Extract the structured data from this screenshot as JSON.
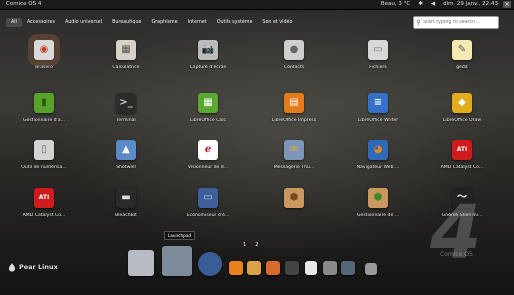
{
  "topbar": {
    "os_name": "Comice OS 4",
    "weather": "Beau, 3 °C",
    "bluetooth_icon": "bluetooth-icon",
    "volume_icon": "volume-icon",
    "datetime": "dim. 29 janv., 22:43",
    "close_glyph": "×"
  },
  "categories": [
    "All",
    "Accessoires",
    "Audio universel",
    "Bureautique",
    "Graphisme",
    "Internet",
    "Outils système",
    "Son et vidéo"
  ],
  "search": {
    "placeholder": "Start typing to search..."
  },
  "apps": [
    {
      "label": "Brasero",
      "color": "#d9d9d9",
      "accent": "#cc3a1a",
      "glyph": "◉"
    },
    {
      "label": "Calculatrice",
      "color": "#d6d3c6",
      "accent": "#555",
      "glyph": "▦"
    },
    {
      "label": "Capture d'écran",
      "color": "#bbbbbb",
      "accent": "#333",
      "glyph": "📷"
    },
    {
      "label": "Contacts",
      "color": "#cfcfcf",
      "accent": "#666",
      "glyph": "●"
    },
    {
      "label": "Fichiers",
      "color": "#d8d8d8",
      "accent": "#777",
      "glyph": "▭"
    },
    {
      "label": "gedit",
      "color": "#f4e9b0",
      "accent": "#556",
      "glyph": "✎"
    },
    {
      "label": "Gestionnaire d'a...",
      "color": "#58a22c",
      "accent": "#2d5a12",
      "glyph": "▮"
    },
    {
      "label": "Terminal",
      "color": "#2b2b2b",
      "accent": "#ccc",
      "glyph": ">_"
    },
    {
      "label": "LibreOffice Calc",
      "color": "#5aa832",
      "accent": "#fff",
      "glyph": "▦"
    },
    {
      "label": "LibreOffice Impress",
      "color": "#e47a1a",
      "accent": "#fff",
      "glyph": "▤"
    },
    {
      "label": "LibreOffice Writer",
      "color": "#3571c8",
      "accent": "#fff",
      "glyph": "≡"
    },
    {
      "label": "LibreOffice Draw",
      "color": "#e3ac1c",
      "accent": "#fff",
      "glyph": "◆"
    },
    {
      "label": "Outil de numérisa...",
      "color": "#d3d3d3",
      "accent": "#666",
      "glyph": "▯"
    },
    {
      "label": "Shotwell",
      "color": "#5a8ac8",
      "accent": "#fff",
      "glyph": "▲"
    },
    {
      "label": "Visionneur de d...",
      "color": "#ffffff",
      "accent": "#c0181e",
      "glyph": "ℯ"
    },
    {
      "label": "Messagerie Thu...",
      "color": "#7d95ba",
      "accent": "#d8b030",
      "glyph": "✉"
    },
    {
      "label": "Navigateur Web ...",
      "color": "#2e6ab8",
      "accent": "#e8861c",
      "glyph": "◕"
    },
    {
      "label": "AMD Catalyst Co...",
      "color": "#cf1b1b",
      "accent": "#fff",
      "glyph": "ATI"
    },
    {
      "label": "AMD Catalyst Co...",
      "color": "#cf1b1b",
      "accent": "#fff",
      "glyph": "ATI"
    },
    {
      "label": "BleachBit",
      "color": "#2a2a2a",
      "accent": "#ddd",
      "glyph": "▬"
    },
    {
      "label": "Économiseur d'é...",
      "color": "#3e5e9c",
      "accent": "#bcd",
      "glyph": "▭"
    },
    {
      "label": "",
      "color": "#c9985e",
      "accent": "#7a4a1e",
      "glyph": "⬢"
    },
    {
      "label": "Gestionnaire de ...",
      "color": "#c9985e",
      "accent": "#3a8a2a",
      "glyph": "⬢"
    },
    {
      "label": "Gnome Shell Ini...",
      "color": "#222222",
      "accent": "#eee",
      "glyph": "〜"
    }
  ],
  "tooltip": "Launchpad",
  "pages": [
    "1",
    "2"
  ],
  "dock": {
    "brand_text": "Pear Linux",
    "items": [
      {
        "name": "display-settings-icon",
        "color": "#b7bbc2"
      },
      {
        "name": "launchpad-icon",
        "color": "#7c8a99"
      },
      {
        "name": "app-store-icon",
        "color": "#3a5e93"
      },
      {
        "name": "firefox-icon",
        "color": "#e8821c"
      },
      {
        "name": "settings-icon",
        "color": "#d9a24a"
      },
      {
        "name": "photos-icon",
        "color": "#d86a30"
      },
      {
        "name": "video-player-icon",
        "color": "#444444"
      },
      {
        "name": "documents-icon",
        "color": "#e8e8e8"
      },
      {
        "name": "contacts-icon",
        "color": "#8a8a8a"
      },
      {
        "name": "system-monitor-icon",
        "color": "#556677"
      },
      {
        "name": "trash-icon",
        "color": "#999999"
      }
    ]
  },
  "watermark": {
    "number": "4",
    "brand": "Comice OS"
  }
}
